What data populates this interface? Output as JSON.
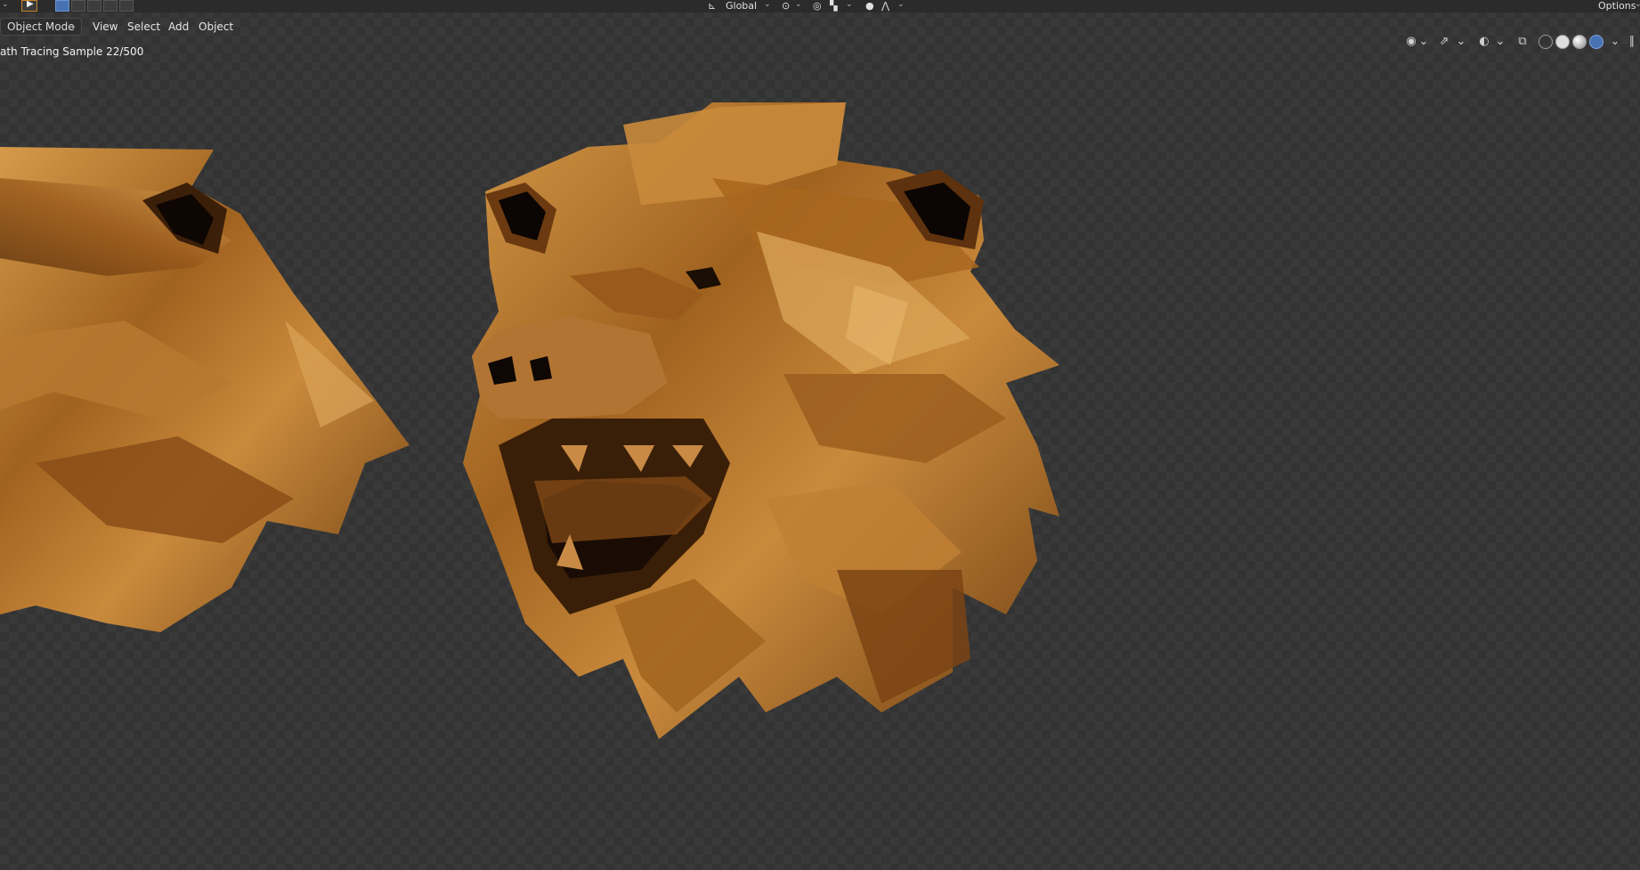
{
  "header": {
    "transform_orientation": "Global",
    "options_label": "Options"
  },
  "menubar": {
    "mode": "Object Mode",
    "items": [
      "View",
      "Select",
      "Add",
      "Object"
    ]
  },
  "viewport": {
    "render_status": "ath Tracing Sample 22/500"
  },
  "icons": {
    "select-tool": "cursor-arrow-icon",
    "transform-orientation": "axes-icon",
    "pivot": "pivot-icon",
    "snap": "magnet-icon",
    "proportional": "proportional-edit-icon",
    "visibility": "eye-icon",
    "gizmo": "gizmo-icon",
    "overlay": "overlay-icon",
    "xray": "xray-icon",
    "shading": [
      "wireframe-icon",
      "solid-icon",
      "material-preview-icon",
      "rendered-icon"
    ]
  },
  "colors": {
    "accent": "#4772b3",
    "wood": "#b0702a",
    "viewport_bg": "#393939"
  }
}
